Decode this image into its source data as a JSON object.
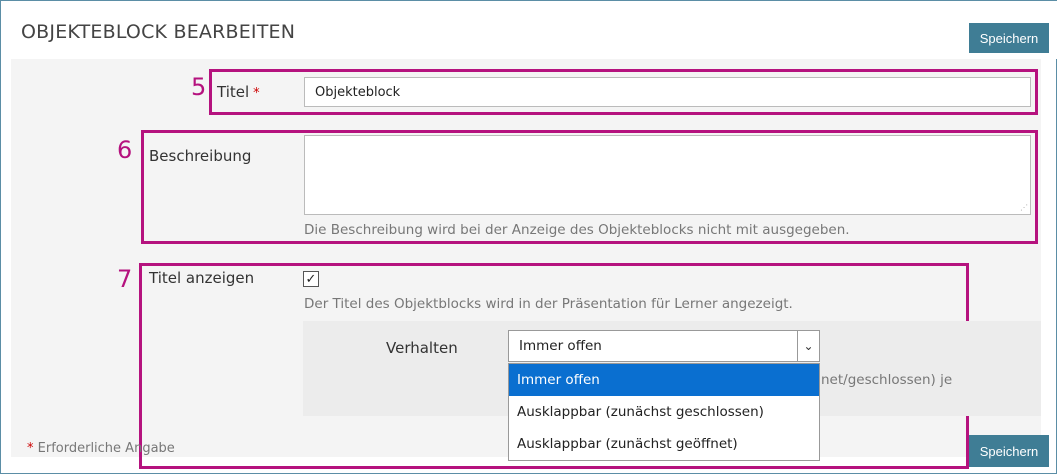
{
  "header": {
    "title": "OBJEKTEBLOCK BEARBEITEN",
    "save_label": "Speichern"
  },
  "annotations": {
    "n5": "5",
    "n6": "6",
    "n7": "7"
  },
  "fields": {
    "title": {
      "label": "Titel",
      "required_mark": "*",
      "value": "Objekteblock"
    },
    "description": {
      "label": "Beschreibung",
      "value": "",
      "help": "Die Beschreibung wird bei der Anzeige des Objekteblocks nicht mit ausgegeben."
    },
    "show_title": {
      "label": "Titel anzeigen",
      "checked": true,
      "check_glyph": "✓",
      "help": "Der Titel des Objektblocks wird in der Präsentation für Lerner angezeigt."
    },
    "behavior": {
      "label": "Verhalten",
      "selected": "Immer offen",
      "arrow_glyph": "⌄",
      "options": [
        "Immer offen",
        "Ausklappbar (zunächst geschlossen)",
        "Ausklappbar (zunächst geöffnet)"
      ],
      "partial_help": "net/geschlossen) je"
    }
  },
  "footer": {
    "required_star": "*",
    "required_note": "Erforderliche Angabe",
    "save_label": "Speichern"
  },
  "colors": {
    "accent": "#3f7d95",
    "highlight": "#b5127e",
    "selected_option": "#0a6fd0"
  }
}
